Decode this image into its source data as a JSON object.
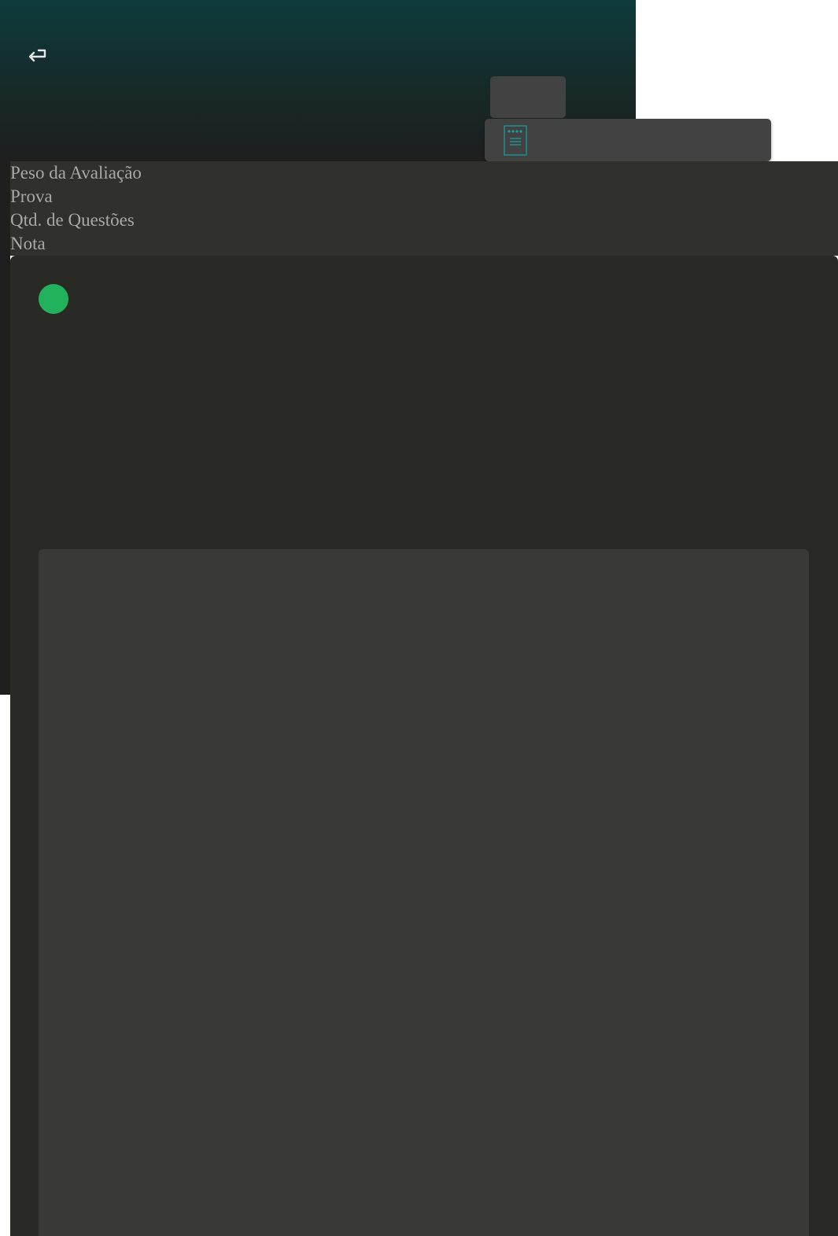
{
  "header": {
    "back_icon": "return-arrow-icon",
    "document_icon": "notepad-document-icon"
  },
  "info": {
    "rows": [
      {
        "label": "Peso da Avaliação"
      },
      {
        "label": "Prova"
      },
      {
        "label": "Qtd. de Questões"
      },
      {
        "label": "Nota"
      }
    ]
  },
  "status": {
    "indicator_color": "#22b25b"
  },
  "colors": {
    "header_top": "#0e3b3b",
    "panel": "#292926",
    "card": "#393935",
    "accent_teal": "#18a2a2"
  }
}
